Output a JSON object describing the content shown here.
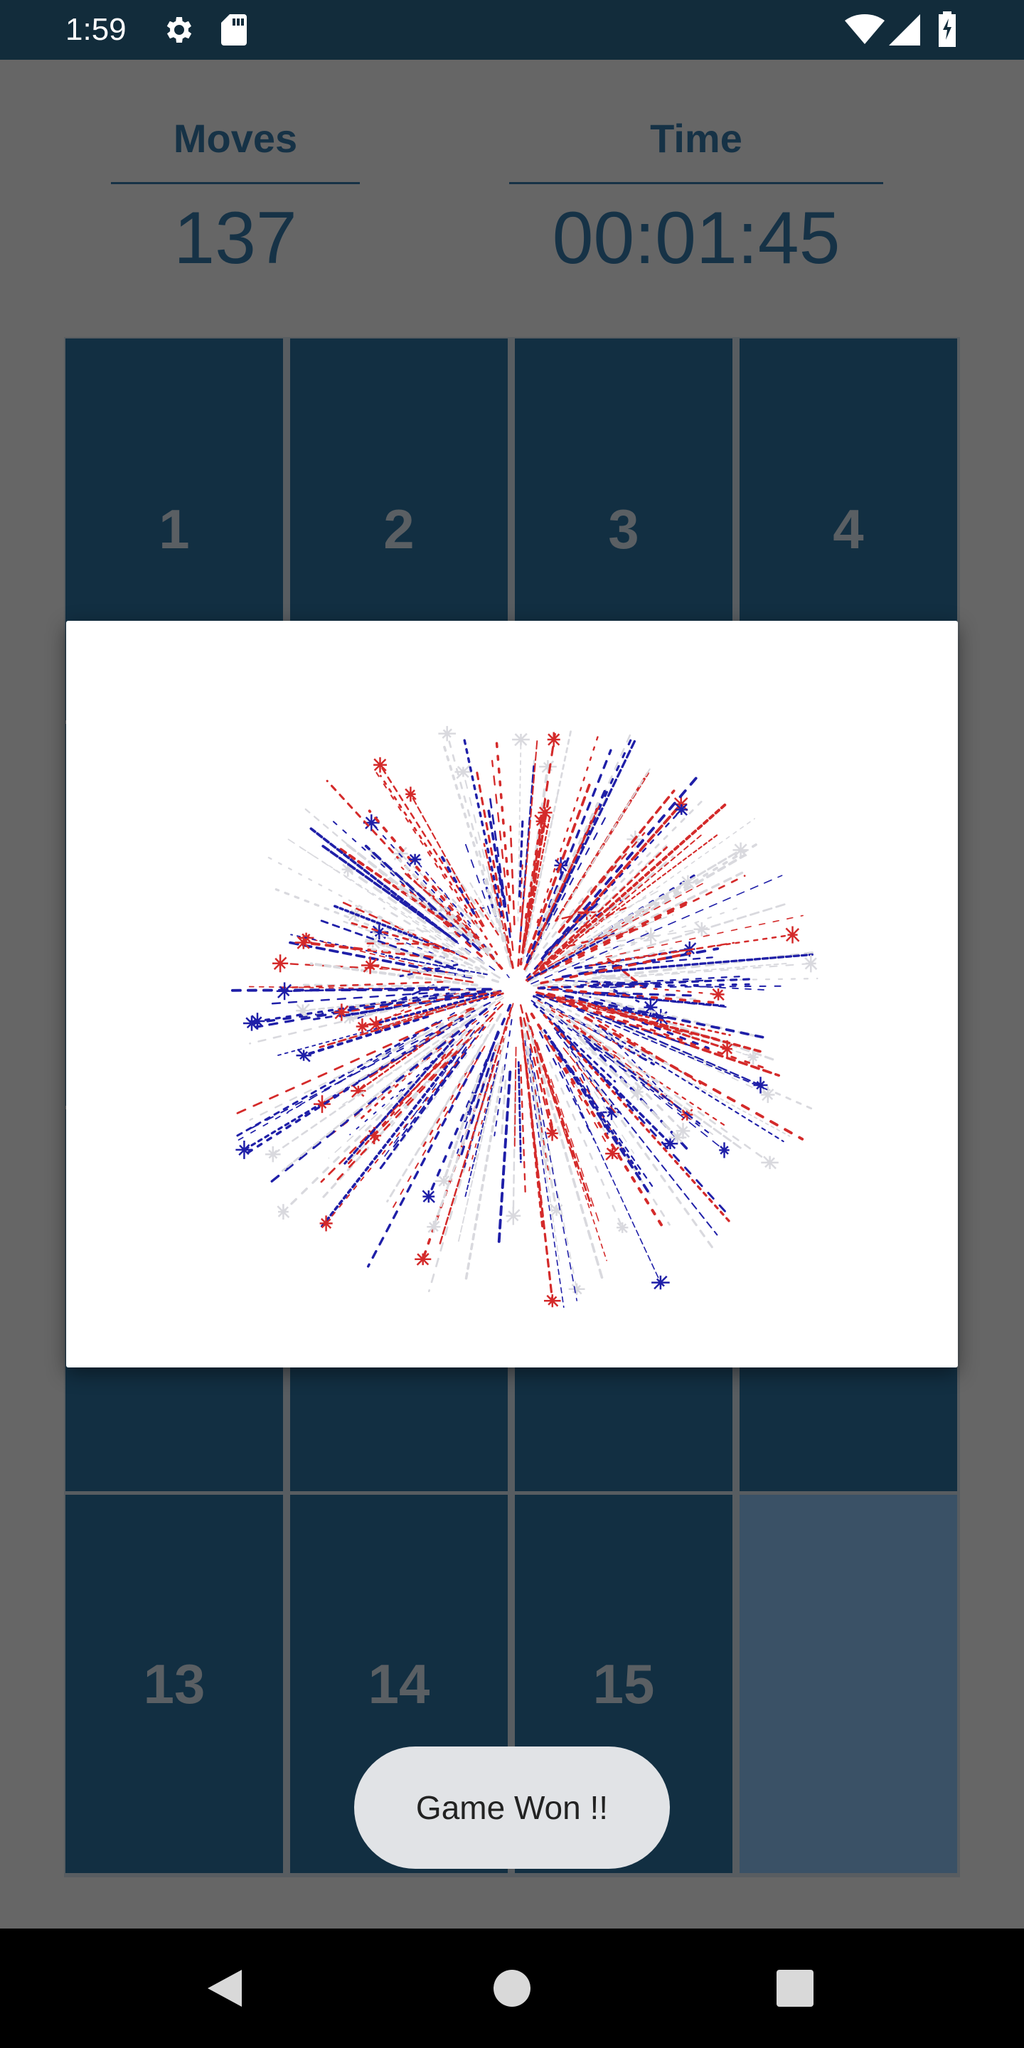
{
  "status_bar": {
    "time": "1:59",
    "icons": [
      "settings-icon",
      "sd-card-icon",
      "wifi-icon",
      "signal-icon",
      "battery-charging-icon"
    ]
  },
  "stats": {
    "moves_label": "Moves",
    "moves_value": "137",
    "time_label": "Time",
    "time_value": "00:01:45"
  },
  "board": {
    "tiles": [
      "1",
      "2",
      "3",
      "4",
      "",
      "",
      "",
      "",
      "",
      "",
      "",
      "",
      "13",
      "14",
      "15",
      ""
    ]
  },
  "dialog": {
    "image": "fireworks",
    "colors": [
      "#d42a2a",
      "#1f1fa8",
      "#d9d9de"
    ]
  },
  "toast": {
    "message": "Game Won !!"
  },
  "nav_bar": {
    "icons": [
      "back-icon",
      "home-icon",
      "recents-icon"
    ]
  },
  "colors": {
    "tile": "#122f42",
    "empty_tile": "#3a5166",
    "primary_text": "#163246"
  }
}
